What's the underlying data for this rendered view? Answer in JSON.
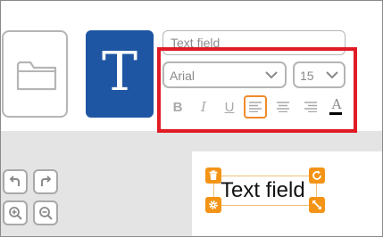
{
  "toolbar": {
    "image_tool_icon": "folder-icon",
    "text_tool_glyph": "T",
    "text_input_placeholder": "Text field",
    "font_family_value": "Arial",
    "font_size_value": "15",
    "format": {
      "bold_label": "B",
      "italic_label": "I",
      "underline_label": "U",
      "color_label": "A",
      "active_alignment": "left"
    }
  },
  "canvas": {
    "text_value": "Text field",
    "controls": [
      "undo-icon",
      "redo-icon",
      "zoom-in-icon",
      "zoom-out-icon"
    ],
    "handle_icons": [
      "trash-icon",
      "rotate-icon",
      "gear-icon",
      "resize-icon"
    ]
  },
  "colors": {
    "accent": "#f39416",
    "text_tool_bg": "#1f56a3",
    "highlight": "#e01b24",
    "border_gray": "#b5b5b5",
    "canvas_bg": "#e4e4e4"
  }
}
